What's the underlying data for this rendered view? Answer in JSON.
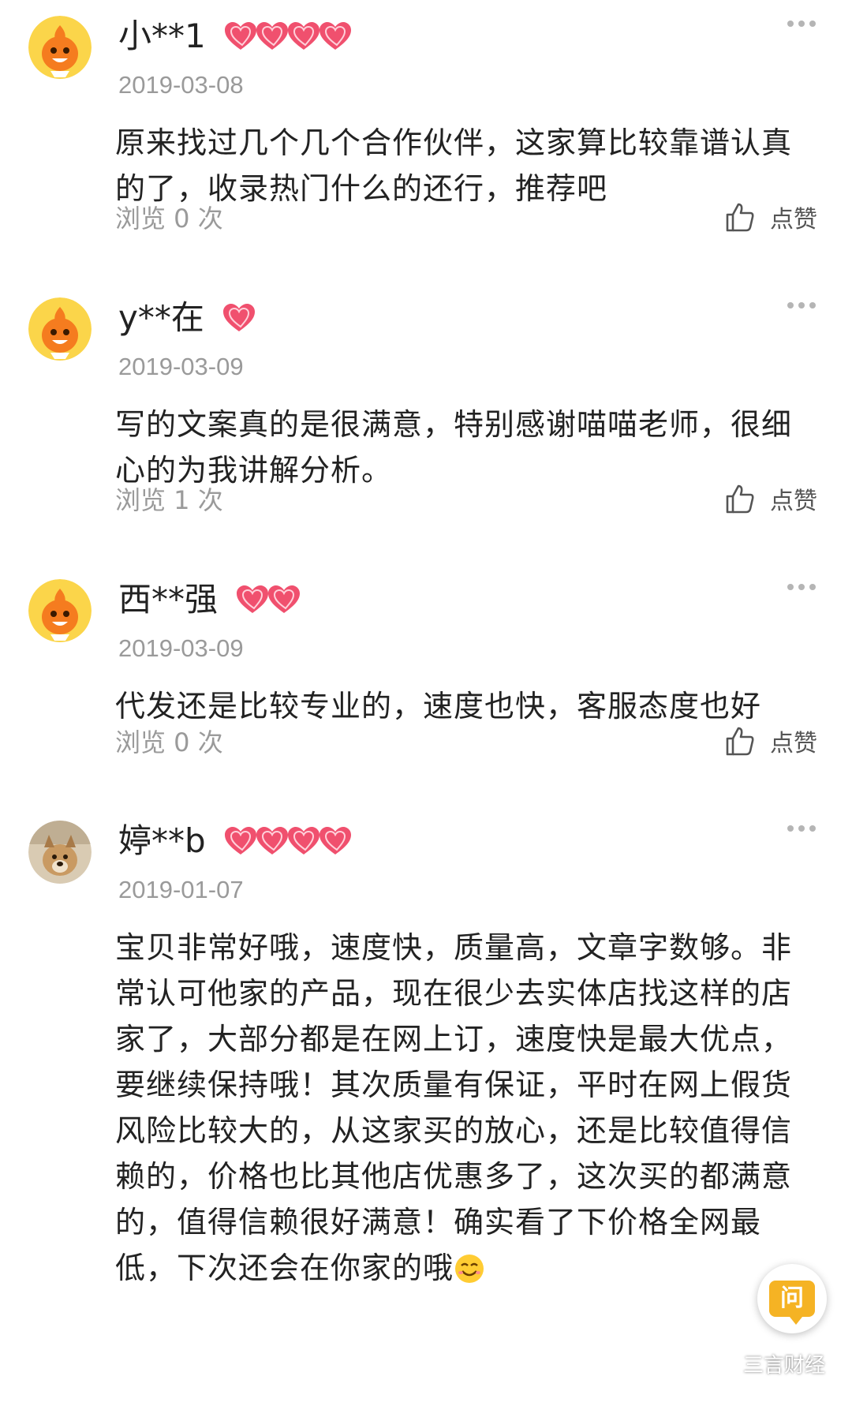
{
  "reviews": [
    {
      "username": "小**1",
      "hearts": 4,
      "avatar": "orange-mascot",
      "date": "2019-03-08",
      "content": "原来找过几个几个合作伙伴，这家算比较靠谱认真的了，收录热门什么的还行，推荐吧",
      "views_label": "浏览 0 次",
      "like_label": "点赞"
    },
    {
      "username": "y**在",
      "hearts": 1,
      "avatar": "orange-mascot",
      "date": "2019-03-09",
      "content": "写的文案真的是很满意，特别感谢喵喵老师，很细心的为我讲解分析。",
      "views_label": "浏览 1 次",
      "like_label": "点赞"
    },
    {
      "username": "西**强",
      "hearts": 2,
      "avatar": "orange-mascot",
      "date": "2019-03-09",
      "content": "代发还是比较专业的，速度也快，客服态度也好",
      "views_label": "浏览 0 次",
      "like_label": "点赞"
    },
    {
      "username": "婷**b",
      "hearts": 4,
      "avatar": "dog-photo",
      "date": "2019-01-07",
      "content": "宝贝非常好哦，速度快，质量高，文章字数够。非常认可他家的产品，现在很少去实体店找这样的店家了，大部分都是在网上订，速度快是最大优点，要继续保持哦！其次质量有保证，平时在网上假货风险比较大的，从这家买的放心，还是比较值得信赖的，价格也比其他店优惠多了，这次买的都满意的，值得信赖很好满意！确实看了下价格全网最低，下次还会在你家的哦",
      "content_emoji": "smile-emoji",
      "views_label": "",
      "like_label": ""
    }
  ],
  "floating_button": {
    "label": "问",
    "icon": "question-bubble-icon"
  },
  "watermark": {
    "icon": "wechat-icon",
    "text": "三言财经"
  },
  "colors": {
    "heart": "#f0506e",
    "heart_light": "#ffd0da",
    "mascot": "#f57c1f",
    "avatar_bg": "#fbd54a",
    "muted": "#9a9a9a",
    "ask_button": "#f5b324"
  }
}
